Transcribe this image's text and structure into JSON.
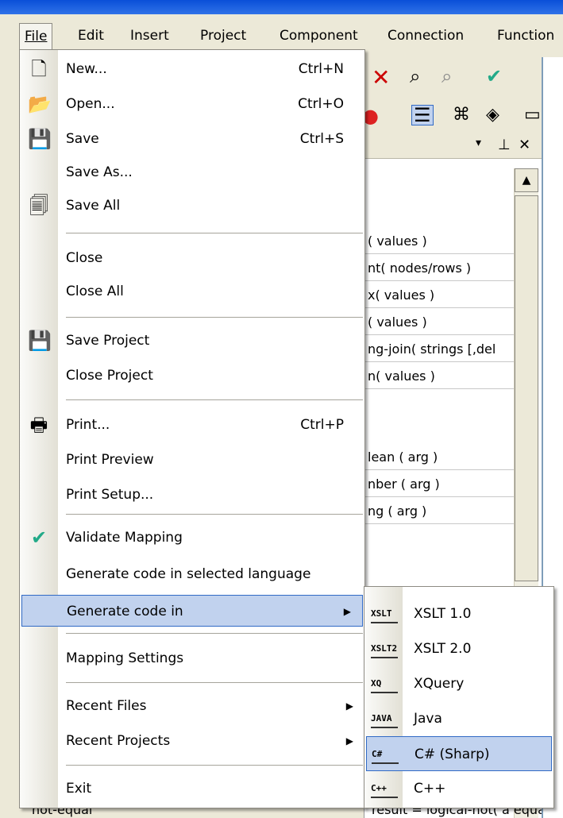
{
  "menubar": {
    "items": [
      "File",
      "Edit",
      "Insert",
      "Project",
      "Component",
      "Connection",
      "Function"
    ]
  },
  "panel_functions": [
    "( values )",
    "nt( nodes/rows )",
    "x( values )",
    "( values )",
    "ng-join( strings [,del",
    "n( values )",
    "lean ( arg )",
    "nber ( arg )",
    "ng ( arg )"
  ],
  "panel_bottom_row": "result = logical-not( a equal b )",
  "bottom_left_text": "not-equal",
  "file_menu": {
    "items": [
      {
        "label": "New...",
        "shortcut": "Ctrl+N",
        "icon": "new-document-icon"
      },
      {
        "label": "Open...",
        "shortcut": "Ctrl+O",
        "icon": "open-folder-icon"
      },
      {
        "label": "Save",
        "shortcut": "Ctrl+S",
        "icon": "save-disk-icon"
      },
      {
        "label": "Save As...",
        "shortcut": "",
        "icon": ""
      },
      {
        "label": "Save All",
        "shortcut": "",
        "icon": "save-all-icon"
      },
      {
        "label": "Close",
        "shortcut": "",
        "icon": ""
      },
      {
        "label": "Close All",
        "shortcut": "",
        "icon": ""
      },
      {
        "label": "Save Project",
        "shortcut": "",
        "icon": "save-project-icon"
      },
      {
        "label": "Close Project",
        "shortcut": "",
        "icon": ""
      },
      {
        "label": "Print...",
        "shortcut": "Ctrl+P",
        "icon": "printer-icon"
      },
      {
        "label": "Print Preview",
        "shortcut": "",
        "icon": ""
      },
      {
        "label": "Print Setup...",
        "shortcut": "",
        "icon": ""
      },
      {
        "label": "Validate Mapping",
        "shortcut": "",
        "icon": "validate-check-icon"
      },
      {
        "label": "Generate code in selected language",
        "shortcut": "",
        "icon": ""
      },
      {
        "label": "Generate code in",
        "shortcut": "",
        "icon": ""
      },
      {
        "label": "Mapping Settings",
        "shortcut": "",
        "icon": ""
      },
      {
        "label": "Recent Files",
        "shortcut": "",
        "icon": ""
      },
      {
        "label": "Recent Projects",
        "shortcut": "",
        "icon": ""
      },
      {
        "label": "Exit",
        "shortcut": "",
        "icon": ""
      }
    ]
  },
  "submenu": {
    "items": [
      {
        "label": "XSLT 1.0",
        "icon_text": "XSLT"
      },
      {
        "label": "XSLT 2.0",
        "icon_text": "XSLT2"
      },
      {
        "label": "XQuery",
        "icon_text": "XQ"
      },
      {
        "label": "Java",
        "icon_text": "JAVA"
      },
      {
        "label": "C# (Sharp)",
        "icon_text": "C#"
      },
      {
        "label": "C++",
        "icon_text": "C++"
      }
    ]
  },
  "colors": {
    "highlight_bg": "#c1d2ee",
    "highlight_border": "#316ac5",
    "menu_bg": "#ece9d8"
  }
}
